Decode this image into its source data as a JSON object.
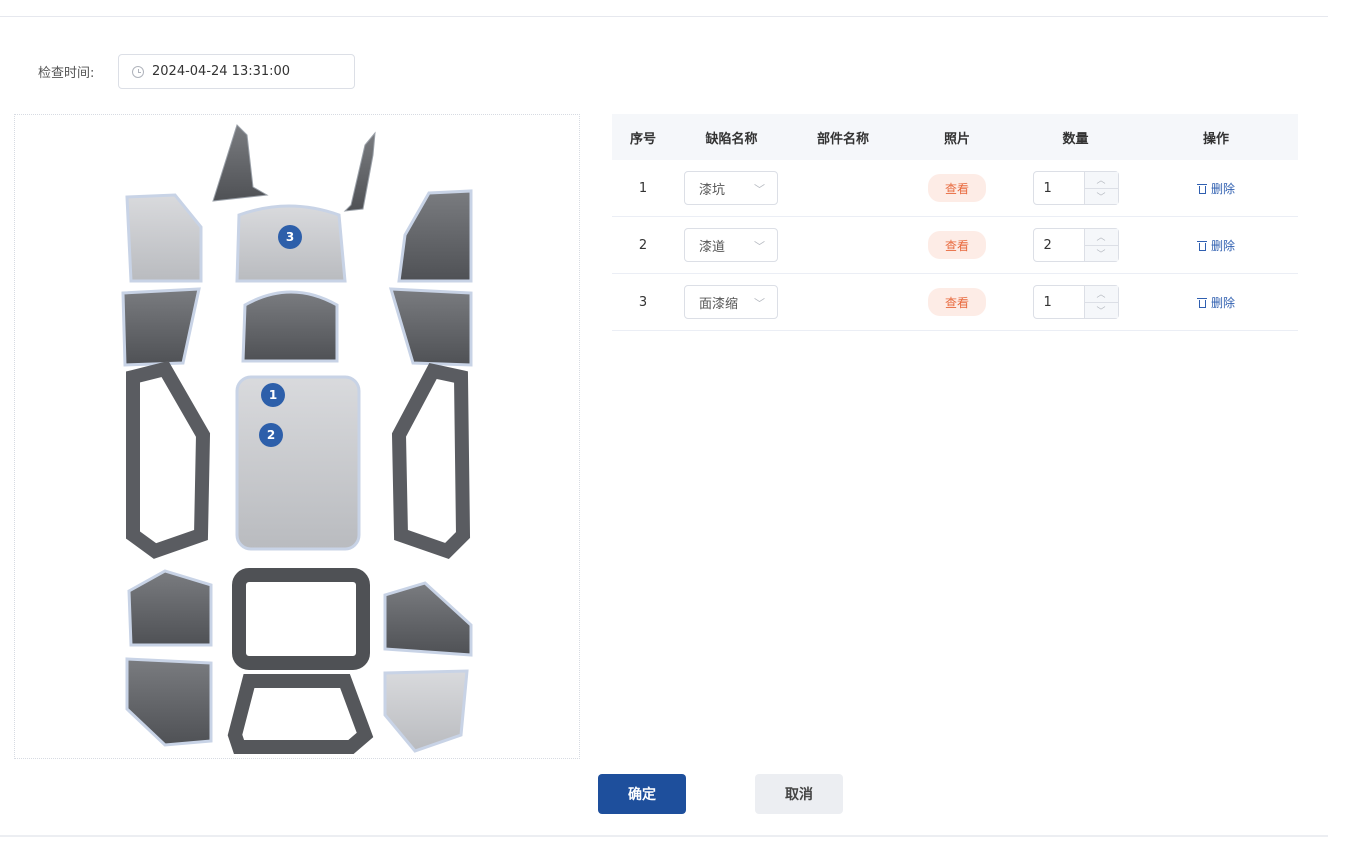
{
  "form": {
    "time_label": "检查时间:",
    "time_value": "2024-04-24 13:31:00"
  },
  "diagram": {
    "markers": [
      "1",
      "2",
      "3"
    ],
    "marker_color": "#2d5faa"
  },
  "table": {
    "headers": {
      "seq": "序号",
      "defect": "缺陷名称",
      "part": "部件名称",
      "photo": "照片",
      "qty": "数量",
      "op": "操作"
    },
    "rows": [
      {
        "seq": "1",
        "defect": "漆坑",
        "part": "",
        "photo": "查看",
        "qty": "1",
        "op": "删除"
      },
      {
        "seq": "2",
        "defect": "漆道",
        "part": "",
        "photo": "查看",
        "qty": "2",
        "op": "删除"
      },
      {
        "seq": "3",
        "defect": "面漆缩",
        "part": "",
        "photo": "查看",
        "qty": "1",
        "op": "删除"
      }
    ]
  },
  "actions": {
    "confirm": "确定",
    "cancel": "取消"
  },
  "colors": {
    "primary": "#1e4f9c",
    "view_bg": "#fdece6",
    "view_text": "#e86a3e",
    "link": "#2f5fb0"
  }
}
